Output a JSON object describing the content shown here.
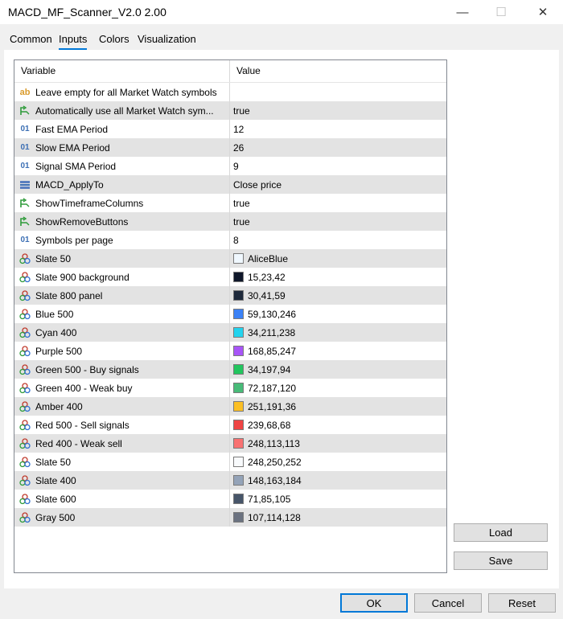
{
  "window": {
    "title": "MACD_MF_Scanner_V2.0 2.00"
  },
  "tabs": [
    {
      "label": "Common"
    },
    {
      "label": "Inputs"
    },
    {
      "label": "Colors"
    },
    {
      "label": "Visualization"
    }
  ],
  "table": {
    "headers": {
      "variable": "Variable",
      "value": "Value"
    },
    "rows": [
      {
        "icon": "text-icon",
        "variable": "Leave empty for all Market Watch symbols",
        "value": ""
      },
      {
        "icon": "bool-icon",
        "variable": "Automatically use all Market Watch sym...",
        "value": "true"
      },
      {
        "icon": "number-icon",
        "variable": "Fast EMA Period",
        "value": "12"
      },
      {
        "icon": "number-icon",
        "variable": "Slow EMA Period",
        "value": "26"
      },
      {
        "icon": "number-icon",
        "variable": "Signal SMA Period",
        "value": "9"
      },
      {
        "icon": "enum-icon",
        "variable": "MACD_ApplyTo",
        "value": "Close price"
      },
      {
        "icon": "bool-icon",
        "variable": "ShowTimeframeColumns",
        "value": "true"
      },
      {
        "icon": "bool-icon",
        "variable": "ShowRemoveButtons",
        "value": "true"
      },
      {
        "icon": "number-icon",
        "variable": "Symbols per page",
        "value": "8"
      },
      {
        "icon": "color-icon",
        "variable": "Slate 50",
        "value": "AliceBlue",
        "color": "#f0f8ff"
      },
      {
        "icon": "color-icon",
        "variable": "Slate 900 background",
        "value": "15,23,42",
        "color": "#0f172a"
      },
      {
        "icon": "color-icon",
        "variable": "Slate 800 panel",
        "value": "30,41,59",
        "color": "#1e293b"
      },
      {
        "icon": "color-icon",
        "variable": "Blue 500",
        "value": "59,130,246",
        "color": "#3b82f6"
      },
      {
        "icon": "color-icon",
        "variable": "Cyan 400",
        "value": "34,211,238",
        "color": "#22d3ee"
      },
      {
        "icon": "color-icon",
        "variable": "Purple 500",
        "value": "168,85,247",
        "color": "#a855f7"
      },
      {
        "icon": "color-icon",
        "variable": "Green 500 - Buy signals",
        "value": "34,197,94",
        "color": "#22c55e"
      },
      {
        "icon": "color-icon",
        "variable": "Green 400 - Weak buy",
        "value": "72,187,120",
        "color": "#48bb78"
      },
      {
        "icon": "color-icon",
        "variable": "Amber 400",
        "value": "251,191,36",
        "color": "#fbbf24"
      },
      {
        "icon": "color-icon",
        "variable": "Red 500 - Sell signals",
        "value": "239,68,68",
        "color": "#ef4444"
      },
      {
        "icon": "color-icon",
        "variable": "Red 400 - Weak sell",
        "value": "248,113,113",
        "color": "#f87171"
      },
      {
        "icon": "color-icon",
        "variable": "Slate 50",
        "value": "248,250,252",
        "color": "#f8fafc"
      },
      {
        "icon": "color-icon",
        "variable": "Slate 400",
        "value": "148,163,184",
        "color": "#94a3b8"
      },
      {
        "icon": "color-icon",
        "variable": "Slate 600",
        "value": "71,85,105",
        "color": "#475569"
      },
      {
        "icon": "color-icon",
        "variable": "Gray 500",
        "value": "107,114,128",
        "color": "#6b7280"
      }
    ]
  },
  "side_buttons": {
    "load": "Load",
    "save": "Save"
  },
  "buttons": {
    "ok": "OK",
    "cancel": "Cancel",
    "reset": "Reset"
  },
  "colors": {
    "accent": "#0078d7",
    "alt_row": "#e3e3e3"
  }
}
